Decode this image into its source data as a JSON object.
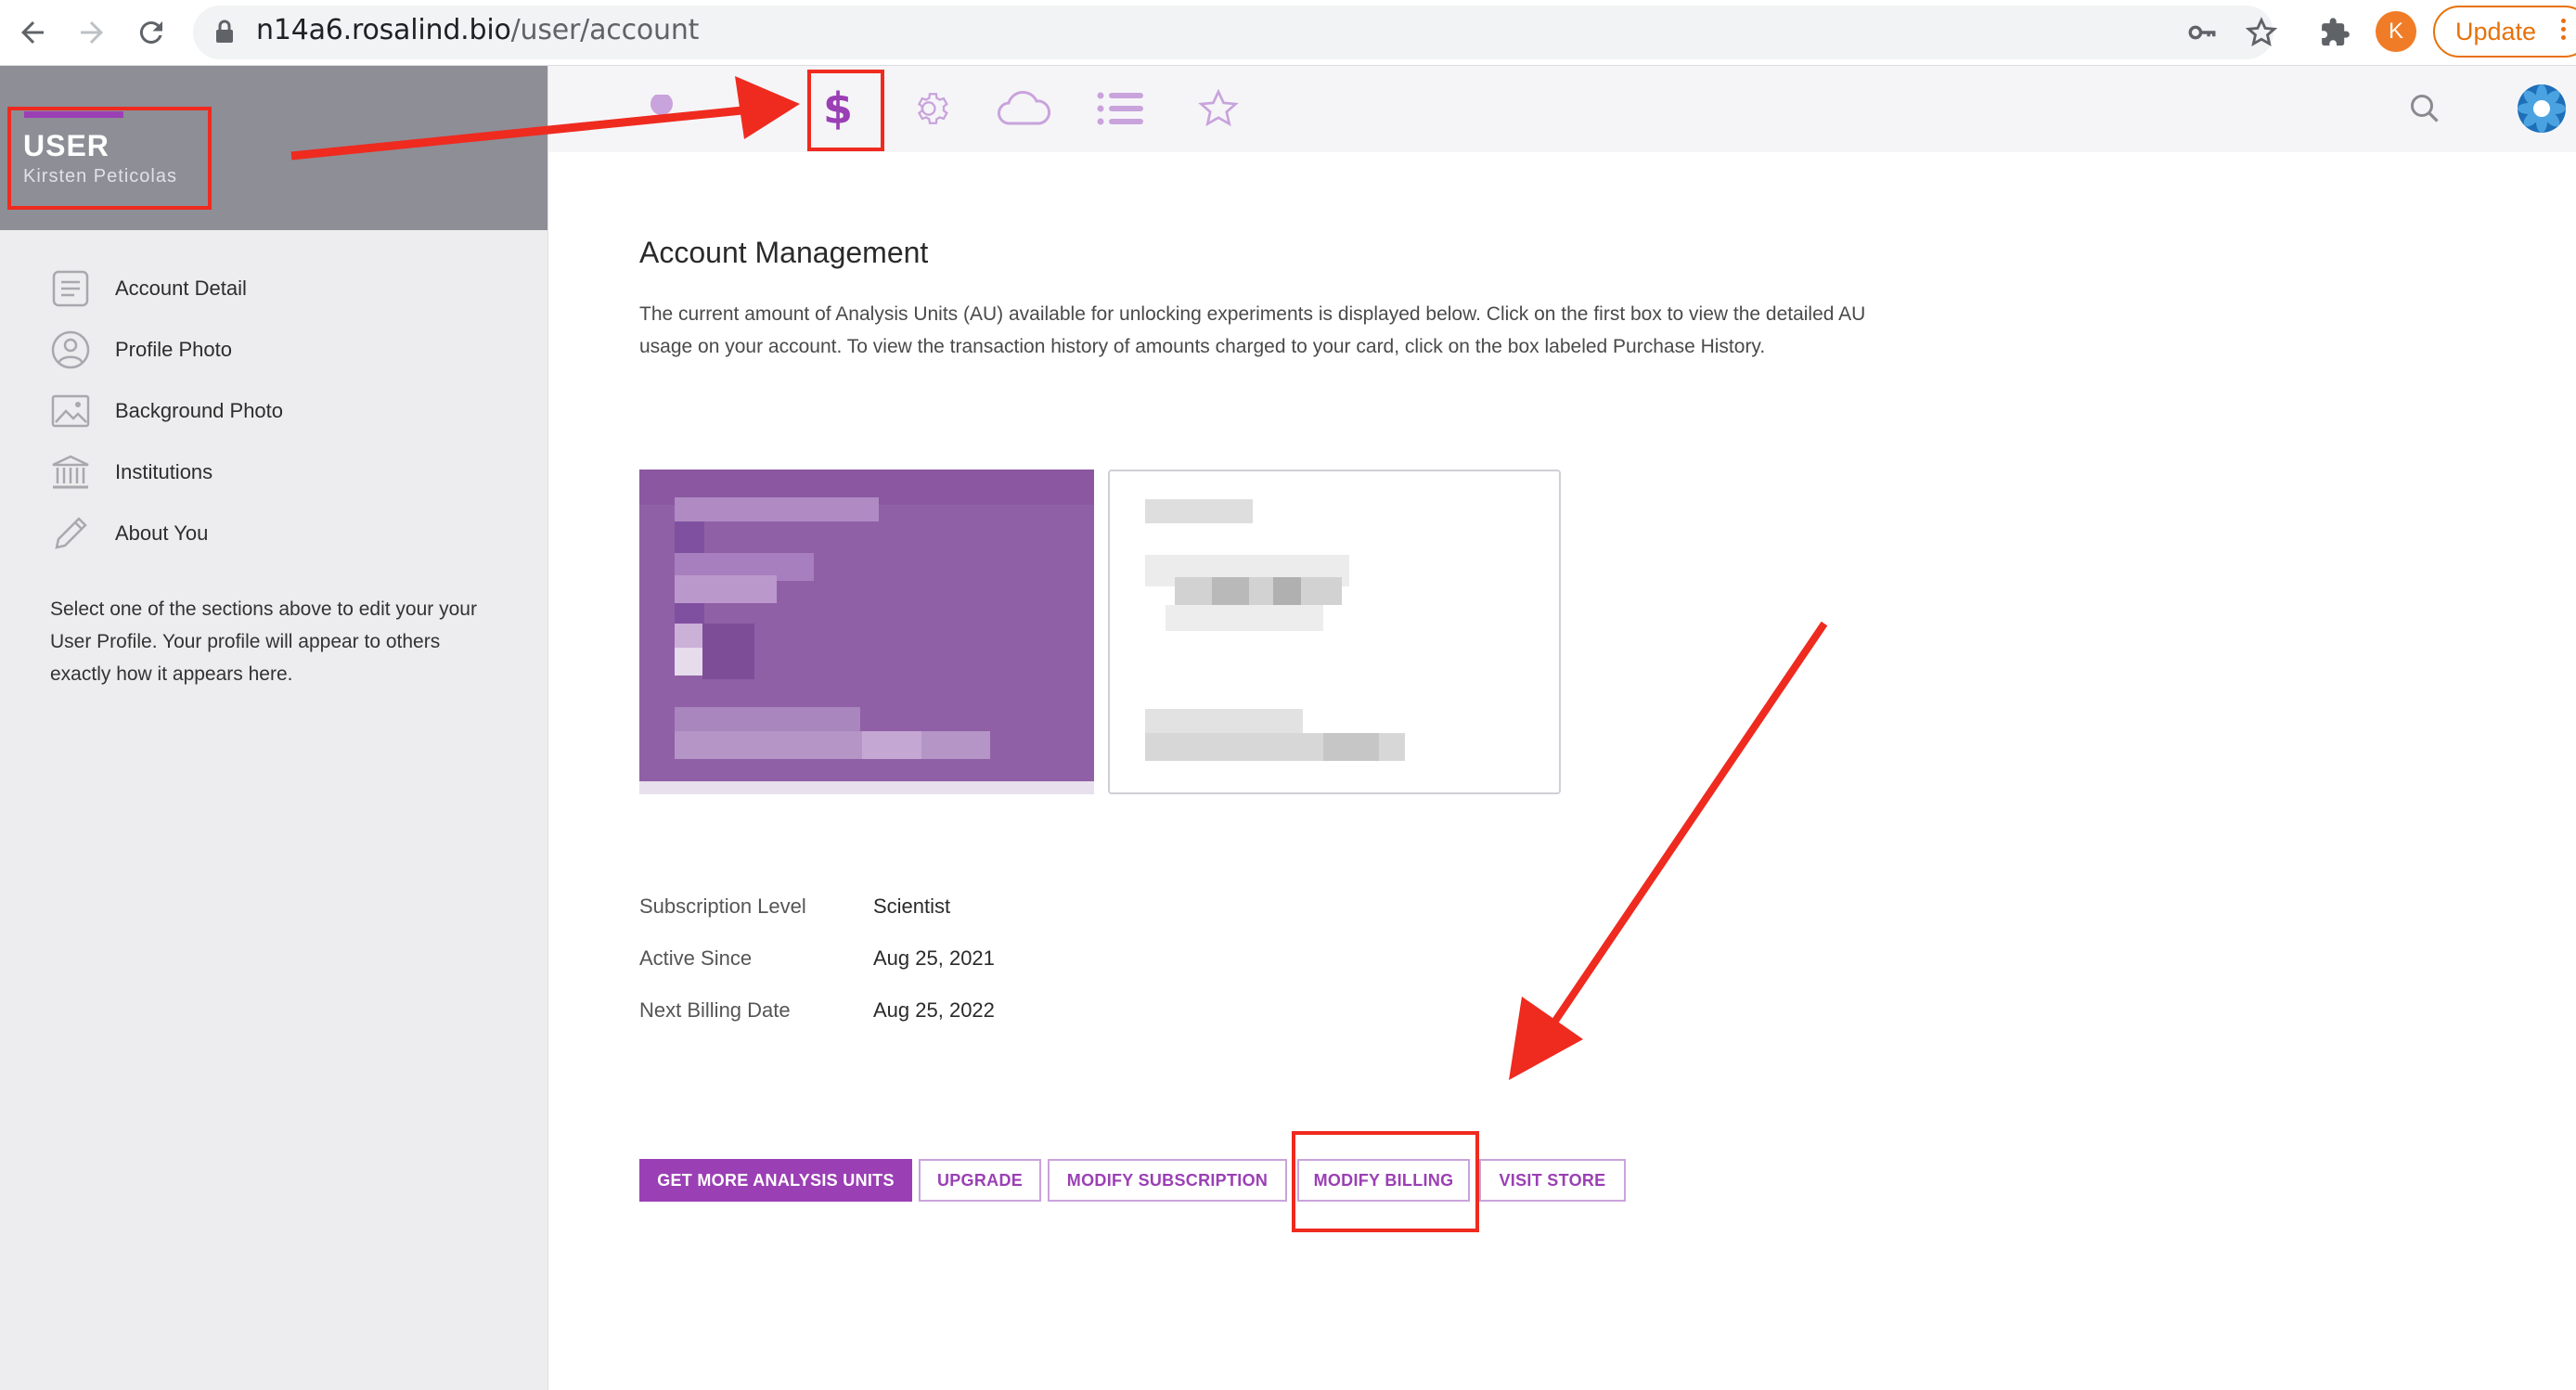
{
  "colors": {
    "brand_purple": "#9b3fb5",
    "purple_light": "#c9a3dc",
    "annotation_red": "#ef2a1f",
    "sidebar_header": "#8e8e96",
    "update_orange": "#e8710a",
    "avatar_orange": "#f07c27"
  },
  "browser": {
    "url_host": "n14a6.rosalind.bio",
    "url_path": "/user/account",
    "avatar_letter": "K",
    "update_label": "Update",
    "icons": [
      "back-icon",
      "forward-icon",
      "reload-icon",
      "lock-icon",
      "key-icon",
      "star-icon",
      "extensions-icon",
      "kebab-menu-icon"
    ]
  },
  "sidebar": {
    "title": "USER",
    "user_name": "Kirsten Peticolas",
    "items": [
      {
        "label": "Account Detail",
        "icon": "document-icon"
      },
      {
        "label": "Profile Photo",
        "icon": "person-icon"
      },
      {
        "label": "Background Photo",
        "icon": "image-icon"
      },
      {
        "label": "Institutions",
        "icon": "bank-icon"
      },
      {
        "label": "About You",
        "icon": "pencil-icon"
      }
    ],
    "note": "Select one of the sections above to edit your your User Profile. Your profile will appear to others exactly how it appears here."
  },
  "toolbar": {
    "icons": [
      "home-dot-icon",
      "dollar-icon",
      "gear-icon",
      "cloud-icon",
      "list-icon",
      "star-icon",
      "search-icon",
      "app-logo-icon"
    ],
    "active": "dollar-icon",
    "dollar_glyph": "$"
  },
  "main": {
    "title": "Account Management",
    "description": "The current amount of Analysis Units (AU) available for unlocking experiments is displayed below. Click on the first box to view the detailed AU usage on your account. To view the transaction history of amounts charged to your card, click on the box labeled Purchase History.",
    "cards": [
      "au-usage-card (pixelated)",
      "purchase-history-card (pixelated)"
    ],
    "info": [
      {
        "label": "Subscription Level",
        "value": "Scientist"
      },
      {
        "label": "Active Since",
        "value": "Aug 25, 2021"
      },
      {
        "label": "Next Billing Date",
        "value": "Aug 25, 2022"
      }
    ],
    "buttons": [
      {
        "label": "GET MORE ANALYSIS UNITS",
        "style": "primary"
      },
      {
        "label": "UPGRADE",
        "style": "outline"
      },
      {
        "label": "MODIFY SUBSCRIPTION",
        "style": "outline"
      },
      {
        "label": "MODIFY BILLING",
        "style": "outline"
      },
      {
        "label": "VISIT STORE",
        "style": "outline"
      }
    ]
  },
  "annotations": [
    "red-box-user-header",
    "red-box-dollar-icon",
    "red-box-modify-billing",
    "red-arrow-to-dollar",
    "red-arrow-to-modify-billing"
  ]
}
